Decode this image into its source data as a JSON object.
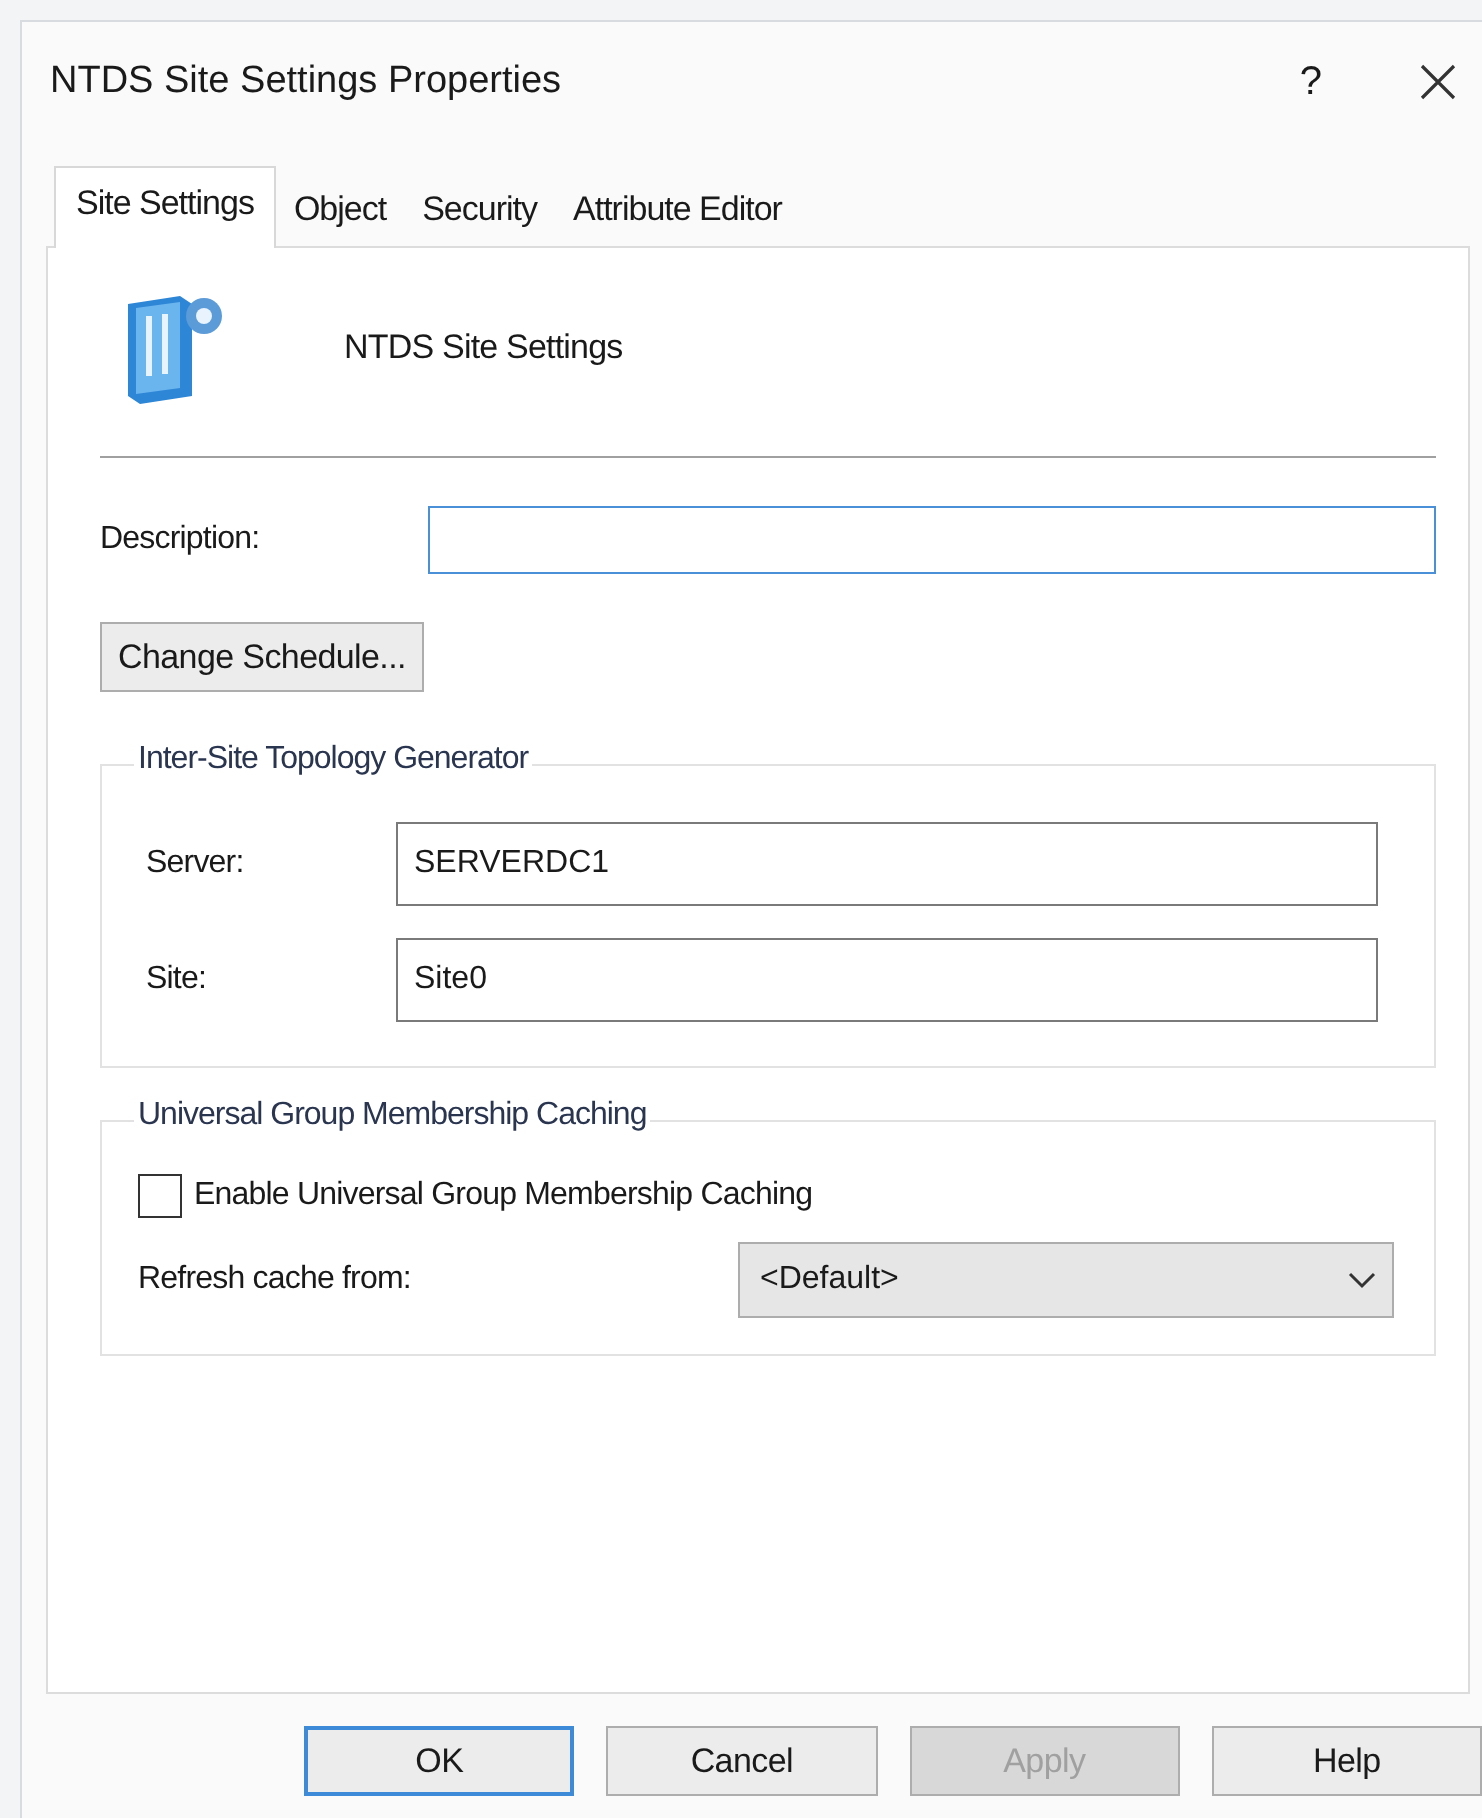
{
  "window": {
    "title": "NTDS Site Settings Properties",
    "help": "?"
  },
  "tabs": [
    {
      "label": "Site Settings",
      "selected": true
    },
    {
      "label": "Object",
      "selected": false
    },
    {
      "label": "Security",
      "selected": false
    },
    {
      "label": "Attribute Editor",
      "selected": false
    }
  ],
  "header": {
    "name": "NTDS Site Settings"
  },
  "description": {
    "label": "Description:",
    "focused": true
  },
  "schedule_button": "Change Schedule...",
  "topology": {
    "title": "Inter-Site Topology Generator",
    "fields": [
      {
        "label": "Server:",
        "value": "SERVERDC1"
      },
      {
        "label": "Site:",
        "value": "Site0"
      }
    ]
  },
  "caching": {
    "title": "Universal Group Membership Caching",
    "checkbox": {
      "label": "Enable Universal Group Membership Caching",
      "checked": false
    },
    "refresh": {
      "label": "Refresh cache from:",
      "value": "<Default>"
    }
  },
  "buttons": [
    {
      "label": "OK",
      "default": true,
      "disabled": false
    },
    {
      "label": "Cancel",
      "default": false,
      "disabled": false
    },
    {
      "label": "Apply",
      "default": false,
      "disabled": true
    },
    {
      "label": "Help",
      "default": false,
      "disabled": false
    }
  ]
}
